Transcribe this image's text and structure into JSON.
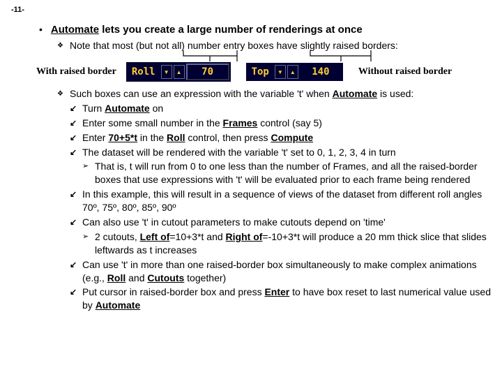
{
  "page_number": "-11-",
  "main": {
    "automate": "Automate",
    "rest": " lets you create a large number of renderings at once"
  },
  "note_line": "Note that most (but not all) number entry boxes have slightly raised borders:",
  "labels": {
    "with": "With raised border",
    "without": "Without raised border"
  },
  "widget": {
    "roll_label": "Roll",
    "roll_value": "70",
    "top_label": "Top",
    "top_value": "140"
  },
  "p1a": "Such boxes can use an expression with the variable 't' when ",
  "p1b": "Automate",
  "p1c": " is used:",
  "s1a": "Turn ",
  "s1b": "Automate",
  "s1c": " on",
  "s2a": "Enter some small number in the ",
  "s2b": "Frames",
  "s2c": " control (say 5)",
  "s3a": "Enter ",
  "s3b": "70+5*t",
  "s3c": " in the ",
  "s3d": "Roll",
  "s3e": " control, then press ",
  "s3f": "Compute",
  "s4": "The dataset will be rendered with the variable 't' set to 0, 1, 2, 3, 4 in turn",
  "s4sub": "That is, t will run from 0 to one less than the number of Frames, and all the raised-border boxes that use expressions with 't' will be evaluated prior to each frame being rendered",
  "s5": "In this example, this will result in a sequence of views of the dataset from different roll angles 70º, 75º, 80º, 85º, 90º",
  "s6": "Can also use 't' in cutout parameters to make cutouts depend on 'time'",
  "s6sub_a": "2 cutouts, ",
  "s6sub_b": "Left of",
  "s6sub_c": "=10+3*t and ",
  "s6sub_d": "Right of",
  "s6sub_e": "=-10+3*t will produce a 20 mm thick slice that slides leftwards as t increases",
  "s7a": "Can use 't' in more than one raised-border box simultaneously to make complex animations (e.g., ",
  "s7b": "Roll",
  "s7c": " and ",
  "s7d": "Cutouts",
  "s7e": " together)",
  "s8a": "Put cursor in raised-border box and press ",
  "s8b": "Enter",
  "s8c": " to have box reset to last numerical value used by ",
  "s8d": "Automate"
}
